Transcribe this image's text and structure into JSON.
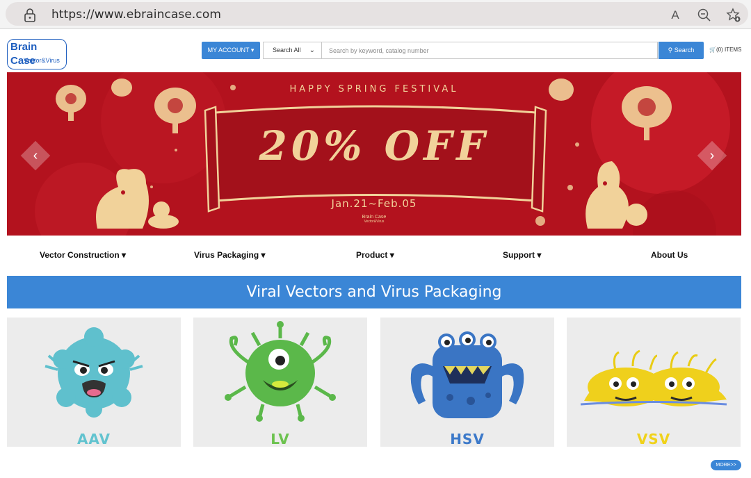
{
  "browser": {
    "url": "https://www.ebraincase.com"
  },
  "header": {
    "logo_main": "Brain Case",
    "logo_sub": "Vector&Virus",
    "my_account_label": "MY ACCOUNT ▾",
    "search_scope": "Search All",
    "search_placeholder": "Search by keyword, catalog number",
    "search_button": "Search",
    "cart_label": "(0) ITEMS"
  },
  "banner": {
    "festival": "HAPPY SPRING FESTIVAL",
    "headline": "20% OFF",
    "dates": "Jan.21~Feb.05",
    "logo_main": "Brain Case",
    "logo_sub": "Vector&Virus"
  },
  "nav": {
    "items": [
      {
        "label": "Vector Construction"
      },
      {
        "label": "Virus Packaging"
      },
      {
        "label": "Product"
      },
      {
        "label": "Support"
      },
      {
        "label": "About Us"
      }
    ]
  },
  "section": {
    "title": "Viral Vectors and Virus Packaging"
  },
  "cards": [
    {
      "label": "AAV",
      "color": "#62c3cf"
    },
    {
      "label": "LV",
      "color": "#6cc24f"
    },
    {
      "label": "HSV",
      "color": "#3c79c9"
    },
    {
      "label": "VSV",
      "color": "#f0d21a"
    }
  ],
  "more_label": "MORE>>",
  "colors": {
    "accent": "#3b86d6",
    "banner_red": "#b3121e",
    "gold": "#f1d29a"
  }
}
